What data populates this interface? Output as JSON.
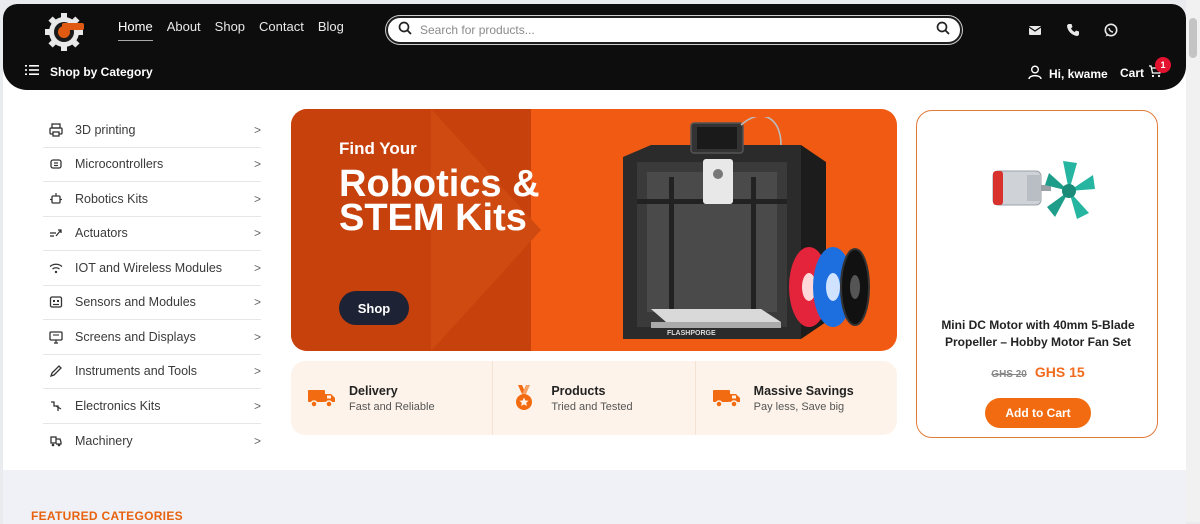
{
  "header": {
    "logo_icon": "gear-logo-icon",
    "nav": [
      "Home",
      "About",
      "Shop",
      "Contact",
      "Blog"
    ],
    "active_nav": "Home",
    "search_placeholder": "Search for products...",
    "contact_icons": [
      "mail-icon",
      "phone-icon",
      "whatsapp-icon"
    ],
    "category_button": "Shop by Category",
    "greeting": "Hi, kwame",
    "cart_label": "Cart",
    "cart_count": "1"
  },
  "sidebar": {
    "items": [
      {
        "label": "3D printing",
        "icon": "printer-icon"
      },
      {
        "label": "Microcontrollers",
        "icon": "chip-icon"
      },
      {
        "label": "Robotics Kits",
        "icon": "robot-icon"
      },
      {
        "label": "Actuators",
        "icon": "actuator-icon"
      },
      {
        "label": "IOT and Wireless Modules",
        "icon": "wifi-icon"
      },
      {
        "label": "Sensors and Modules",
        "icon": "sensor-icon"
      },
      {
        "label": "Screens and Displays",
        "icon": "display-icon"
      },
      {
        "label": "Instruments and Tools",
        "icon": "pencil-tool-icon"
      },
      {
        "label": "Electronics Kits",
        "icon": "circuit-icon"
      },
      {
        "label": "Machinery",
        "icon": "machinery-icon"
      }
    ],
    "chevron": ">"
  },
  "hero": {
    "subtitle": "Find Your",
    "title": "Robotics & STEM Kits",
    "button": "Shop",
    "printer_brand": "FLASHPORGE"
  },
  "features": [
    {
      "title": "Delivery",
      "subtitle": "Fast and Reliable",
      "icon": "truck-icon"
    },
    {
      "title": "Products",
      "subtitle": "Tried and Tested",
      "icon": "medal-icon"
    },
    {
      "title": "Massive Savings",
      "subtitle": "Pay less, Save big",
      "icon": "truck-icon"
    }
  ],
  "product": {
    "name": "Mini DC Motor with 40mm 5-Blade Propeller – Hobby Motor Fan Set",
    "old_price": "GHS 20",
    "new_price": "GHS 15",
    "button": "Add to Cart"
  },
  "featured": {
    "title": "FEATURED CATEGORIES"
  },
  "colors": {
    "accent": "#f26b10",
    "header_bg": "#0d0d0d",
    "badge": "#e3122f"
  }
}
